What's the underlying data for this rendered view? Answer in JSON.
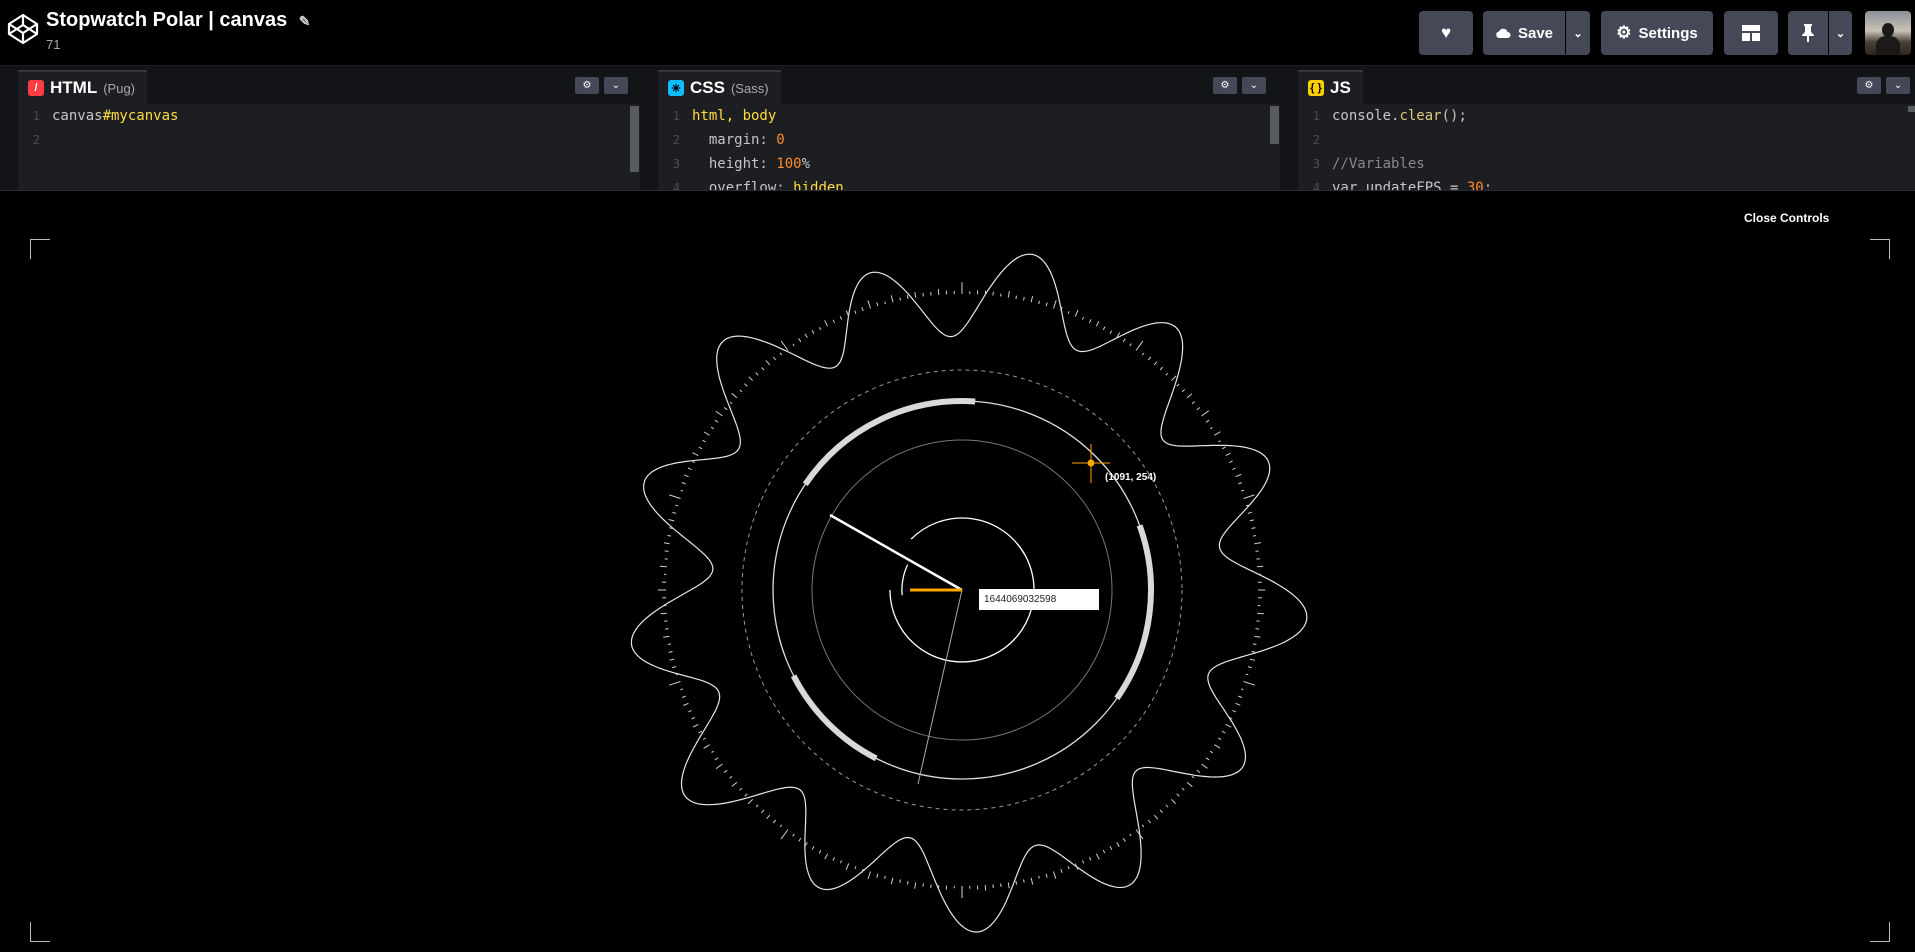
{
  "header": {
    "title": "Stopwatch Polar | canvas",
    "views": "71",
    "save_label": "Save",
    "settings_label": "Settings"
  },
  "editors": {
    "html": {
      "name": "HTML",
      "preprocessor": "(Pug)",
      "lines": [
        {
          "n": "1",
          "parts": [
            {
              "t": "canvas",
              "c": "k-tag"
            },
            {
              "t": "#mycanvas",
              "c": "k-sel"
            }
          ]
        },
        {
          "n": "2",
          "parts": []
        }
      ]
    },
    "css": {
      "name": "CSS",
      "preprocessor": "(Sass)",
      "lines": [
        {
          "n": "1",
          "parts": [
            {
              "t": "html, body",
              "c": "k-sel"
            }
          ]
        },
        {
          "n": "2",
          "parts": [
            {
              "t": "  margin: ",
              "c": "k-prop"
            },
            {
              "t": "0",
              "c": "k-num"
            }
          ]
        },
        {
          "n": "3",
          "parts": [
            {
              "t": "  height: ",
              "c": "k-prop"
            },
            {
              "t": "100",
              "c": "k-num"
            },
            {
              "t": "%",
              "c": "k-prop"
            }
          ]
        },
        {
          "n": "4",
          "parts": [
            {
              "t": "  overflow: ",
              "c": "k-prop"
            },
            {
              "t": "hidden",
              "c": "k-sel"
            }
          ]
        }
      ]
    },
    "js": {
      "name": "JS",
      "lines": [
        {
          "n": "1",
          "parts": [
            {
              "t": "console",
              "c": "k-var"
            },
            {
              "t": ".",
              "c": "k-var"
            },
            {
              "t": "clear",
              "c": "k-fn"
            },
            {
              "t": "();",
              "c": "k-var"
            }
          ]
        },
        {
          "n": "2",
          "parts": []
        },
        {
          "n": "3",
          "parts": [
            {
              "t": "//Variables",
              "c": "k-cm"
            }
          ]
        },
        {
          "n": "4",
          "parts": [
            {
              "t": "var updateFPS = ",
              "c": "k-var"
            },
            {
              "t": "30",
              "c": "k-num"
            },
            {
              "t": ";",
              "c": "k-var"
            }
          ]
        }
      ]
    }
  },
  "preview": {
    "close_controls": "Close Controls",
    "timestamp": "1644069032598",
    "mouse_coord": "(1091, 254)"
  },
  "colors": {
    "accent": "#ffa500",
    "button_bg": "#444857",
    "html_icon": "#ff3c41",
    "css_icon": "#0ebeff",
    "js_icon": "#fcd000"
  }
}
